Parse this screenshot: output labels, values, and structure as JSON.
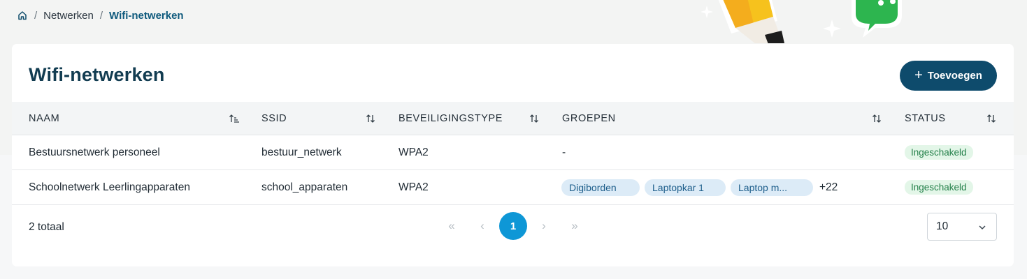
{
  "breadcrumb": {
    "items": [
      "Netwerken",
      "Wifi-netwerken"
    ],
    "separator": "/"
  },
  "page": {
    "title": "Wifi-netwerken",
    "add_button": "Toevoegen"
  },
  "table": {
    "columns": [
      "NAAM",
      "SSID",
      "BEVEILIGINGSTYPE",
      "GROEPEN",
      "STATUS"
    ],
    "rows": [
      {
        "name": "Bestuursnetwerk personeel",
        "ssid": "bestuur_netwerk",
        "security": "WPA2",
        "groups_text": "-",
        "groups": [],
        "status": "Ingeschakeld"
      },
      {
        "name": "Schoolnetwerk Leerlingapparaten",
        "ssid": "school_apparaten",
        "security": "WPA2",
        "groups_text": "",
        "groups": [
          "Digiborden",
          "Laptopkar 1",
          "Laptop m..."
        ],
        "more": "+22",
        "status": "Ingeschakeld"
      }
    ]
  },
  "footer": {
    "total": "2 totaal",
    "first": "«",
    "prev": "‹",
    "current_page": "1",
    "next": "›",
    "last": "»",
    "page_size": "10"
  },
  "colors": {
    "primary": "#0e4b6c",
    "accent": "#0e97d6",
    "status_bg": "#e3f6e8",
    "status_text": "#24804a",
    "chip_bg": "#dcebf7"
  },
  "icons": [
    "home-icon",
    "plus-icon",
    "sort-asc-icon",
    "sort-icon",
    "chevron-down-icon",
    "pencil-illustration",
    "chat-bubble-illustration",
    "sparkle-icon"
  ]
}
